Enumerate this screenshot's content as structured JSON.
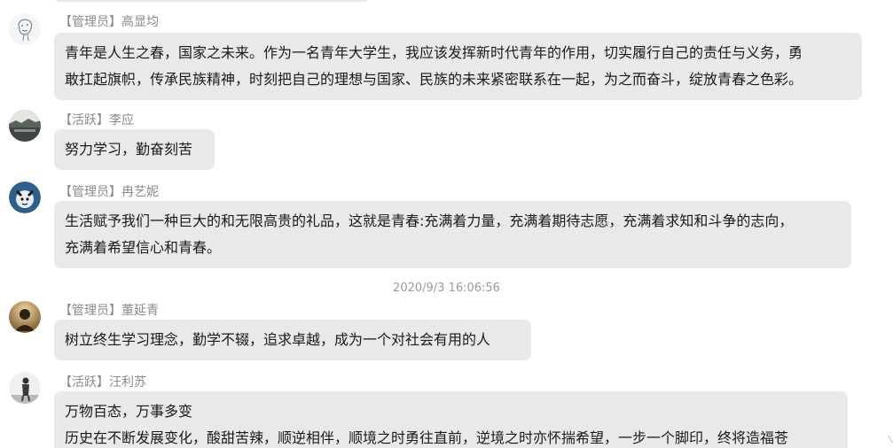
{
  "messages": [
    {
      "sender": "【管理员】高显均",
      "avatar": "sketch-avatar",
      "lines": [
        "青年是人生之春，国家之未来。作为一名青年大学生，我应该发挥新时代青年的作用，切实履行自己的责任与义务，勇",
        "敢扛起旗帜，传承民族精神，时刻把自己的理想与国家、民族的未来紧密联系在一起，为之而奋斗，绽放青春之色彩。"
      ]
    },
    {
      "sender": "【活跃】李应",
      "avatar": "landscape-avatar",
      "lines": [
        "努力学习，勤奋刻苦"
      ]
    },
    {
      "sender": "【管理员】冉艺妮",
      "avatar": "cartoon-avatar",
      "lines": [
        "生活赋予我们一种巨大的和无限高贵的礼品，这就是青春:充满着力量，充满着期待志愿，充满着求知和斗争的志向，",
        "充满着希望信心和青春。"
      ]
    },
    {
      "sender": "【管理员】董延青",
      "avatar": "silhouette-avatar",
      "lines": [
        "树立终生学习理念，勤学不辍，追求卓越，成为一个对社会有用的人"
      ]
    },
    {
      "sender": "【活跃】汪利苏",
      "avatar": "figure-avatar",
      "lines": [
        "万物百态，万事多变",
        "历史在不断发展变化，酸甜苦辣，顺逆相伴，顺境之时勇往直前，逆境之时亦怀揣希望，一步一个脚印，终将造福苍"
      ]
    }
  ],
  "timestamp": "2020/9/3 16:06:56",
  "colors": {
    "bubble": "#e9e9e9",
    "sender": "#8a8a8a",
    "text": "#1a1a1a",
    "timestamp": "#9a9a9a"
  }
}
